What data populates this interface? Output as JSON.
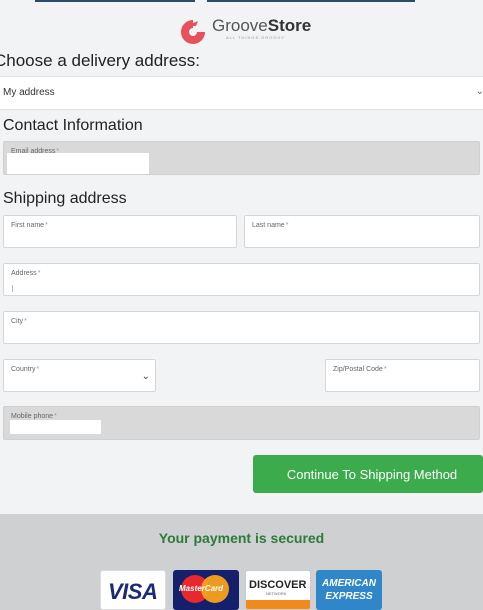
{
  "brand": {
    "name_light": "Groove",
    "name_bold": "Store",
    "tagline": "ALL THINGS GROOVY",
    "accent": "#e8505b"
  },
  "delivery": {
    "heading": "Choose a delivery address:",
    "selected": "My address"
  },
  "contact": {
    "heading": "Contact Information",
    "email_label": "Email address",
    "req": "*"
  },
  "shipping": {
    "heading": "Shipping address",
    "first_name_label": "First name",
    "last_name_label": "Last name",
    "address_label": "Address",
    "city_label": "City",
    "country_label": "Country",
    "zip_label": "Zip/Postal Code",
    "phone_label": "Mobile phone",
    "req": "*"
  },
  "actions": {
    "continue_label": "Continue To Shipping Method",
    "continue_color": "#3bab4c"
  },
  "footer": {
    "secured_text": "Your payment is secured",
    "cards": [
      "VISA",
      "MasterCard",
      "DISCOVER",
      "AMERICAN EXPRESS"
    ],
    "discover_network": "NETWORK",
    "amex_line1": "AMERICAN",
    "amex_line2": "EXPRESS"
  }
}
